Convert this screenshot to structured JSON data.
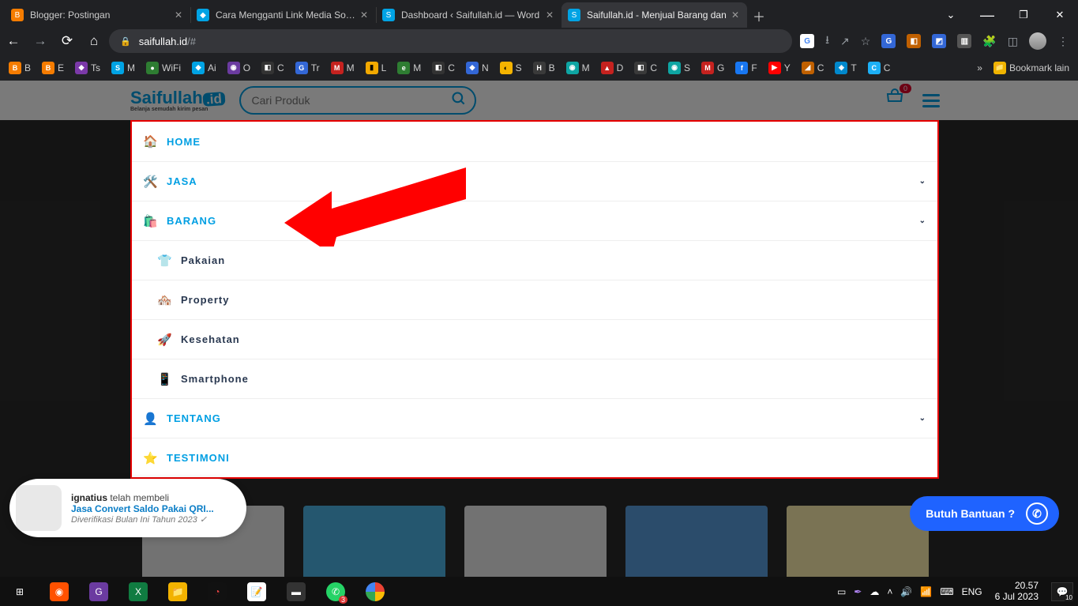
{
  "chrome": {
    "tabs": [
      {
        "title": "Blogger: Postingan",
        "fav_bg": "#f57c00",
        "fav_txt": "B"
      },
      {
        "title": "Cara Mengganti Link Media Sosia",
        "fav_bg": "#00a3e4",
        "fav_txt": "◆"
      },
      {
        "title": "Dashboard ‹ Saifullah.id — Word",
        "fav_bg": "#00a3e4",
        "fav_txt": "S"
      },
      {
        "title": "Saifullah.id - Menjual Barang dan",
        "fav_bg": "#00a3e4",
        "fav_txt": "S",
        "active": true
      }
    ],
    "url_domain": "saifullah.id",
    "url_path": "/#",
    "bookmarks": [
      {
        "label": "B",
        "bg": "#f57c00"
      },
      {
        "label": "B",
        "bg": "#f57c00"
      },
      {
        "label": "E",
        "bg": "#f57c00"
      },
      {
        "label": "Ts",
        "bg": "#7b39a8"
      },
      {
        "label": "S",
        "bg": "#00a3e4"
      },
      {
        "label": "M",
        "bg": "#333"
      },
      {
        "label": "WiFi",
        "bg": "#00a3e4"
      },
      {
        "label": "Ai",
        "bg": "#00a3e4"
      },
      {
        "label": "O",
        "bg": "#6b3ba0"
      },
      {
        "label": "C",
        "bg": "#333"
      },
      {
        "label": "Tr",
        "bg": "#3367d6"
      },
      {
        "label": "M",
        "bg": "#c5221f"
      },
      {
        "label": "L",
        "bg": "#f2a900"
      },
      {
        "label": "M",
        "bg": "#2e7d32"
      },
      {
        "label": "C",
        "bg": "#333"
      },
      {
        "label": "N",
        "bg": "#3367d6"
      },
      {
        "label": "S",
        "bg": "#f5b400"
      },
      {
        "label": "S",
        "bg": "#333"
      },
      {
        "label": "B",
        "bg": "#3a3a3a"
      },
      {
        "label": "M",
        "bg": "#0ea5a3"
      },
      {
        "label": "D",
        "bg": "#c5221f"
      },
      {
        "label": "C",
        "bg": "#3a3a3a"
      },
      {
        "label": "S",
        "bg": "#0ea5a3"
      },
      {
        "label": "G",
        "bg": "#c5221f"
      },
      {
        "label": "F",
        "bg": "#1877f2"
      },
      {
        "label": "Y",
        "bg": "#ff0000"
      },
      {
        "label": "C",
        "bg": "#c06000"
      },
      {
        "label": "T",
        "bg": "#0088cc"
      },
      {
        "label": "C",
        "bg": "#1cb0f6"
      }
    ],
    "bookmark_more": "»",
    "bookmark_folder": "Bookmark lain"
  },
  "site": {
    "logo_main": "Saifullah",
    "logo_badge": ".id",
    "logo_sub": "Belanja semudah kirim pesan",
    "search_placeholder": "Cari Produk",
    "cart_count": "0",
    "menu": [
      {
        "icon": "🏠",
        "label": "HOME",
        "link": true
      },
      {
        "icon": "🛠️",
        "label": "JASA",
        "link": true,
        "chev": true
      },
      {
        "icon": "🛍️",
        "label": "BARANG",
        "link": true,
        "chev": true
      },
      {
        "sub": true,
        "icon": "👕",
        "label": "Pakaian"
      },
      {
        "sub": true,
        "icon": "🏘️",
        "label": "Property"
      },
      {
        "sub": true,
        "icon": "🚀",
        "label": "Kesehatan"
      },
      {
        "sub": true,
        "icon": "📱",
        "label": "Smartphone"
      },
      {
        "icon": "👤",
        "label": "TENTANG",
        "link": true,
        "chev": true
      },
      {
        "icon": "⭐",
        "label": "TESTIMONI",
        "link": true
      }
    ],
    "support_label": "Butuh Bantuan ?"
  },
  "toast": {
    "name": "ignatius",
    "action": " telah membeli",
    "product": "Jasa Convert Saldo Pakai QRI...",
    "verify": "Diverifikasi Bulan Ini Tahun 2023 ✓"
  },
  "taskbar": {
    "lang": "ENG",
    "time": "20.57",
    "date": "6 Jul 2023",
    "notif_count": "10"
  }
}
